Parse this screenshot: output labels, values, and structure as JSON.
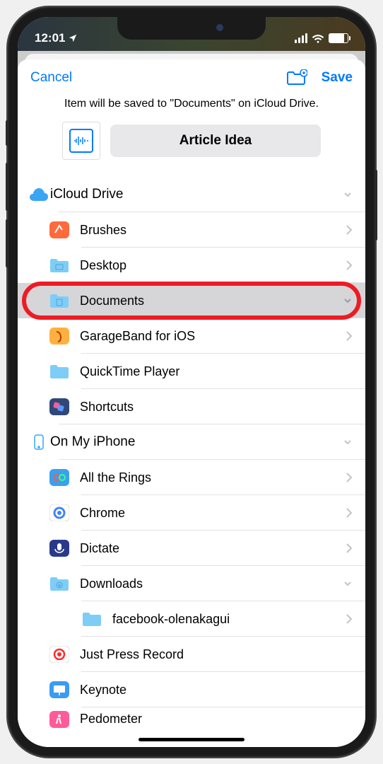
{
  "status": {
    "time": "12:01",
    "location_arrow": "➤"
  },
  "nav": {
    "cancel": "Cancel",
    "save": "Save"
  },
  "info_text": "Item will be saved to \"Documents\" on iCloud Drive.",
  "item_name": "Article Idea",
  "locations": [
    {
      "name": "iCloud Drive",
      "icon": "cloud",
      "expanded": true,
      "folders": [
        {
          "name": "Brushes",
          "icon_color": "#ff6a3c",
          "glyph": "brush",
          "chev": "right"
        },
        {
          "name": "Desktop",
          "icon_color": "#7ecdf7",
          "glyph": "desktop",
          "chev": "right"
        },
        {
          "name": "Documents",
          "icon_color": "#7ecdf7",
          "glyph": "doc",
          "chev": "down",
          "selected": true,
          "highlighted": true
        },
        {
          "name": "GarageBand for iOS",
          "icon_color": "#ff9a3c",
          "glyph": "guitar",
          "chev": "right"
        },
        {
          "name": "QuickTime Player",
          "icon_color": "#7ecdf7",
          "glyph": "folder",
          "chev": "none"
        },
        {
          "name": "Shortcuts",
          "icon_color": "#2a4a8a",
          "glyph": "shortcuts",
          "chev": "none"
        }
      ]
    },
    {
      "name": "On My iPhone",
      "icon": "iphone",
      "expanded": true,
      "folders": [
        {
          "name": "All the Rings",
          "icon_color": "#3aa0f0",
          "glyph": "rings",
          "chev": "right"
        },
        {
          "name": "Chrome",
          "icon_color": "#ffffff",
          "glyph": "chrome",
          "chev": "right"
        },
        {
          "name": "Dictate",
          "icon_color": "#2a3a8a",
          "glyph": "mic",
          "chev": "right"
        },
        {
          "name": "Downloads",
          "icon_color": "#7ecdf7",
          "glyph": "download",
          "chev": "down",
          "children": [
            {
              "name": "facebook-olenakagui",
              "icon_color": "#7ecdf7",
              "glyph": "folder",
              "chev": "right"
            }
          ]
        },
        {
          "name": "Just Press Record",
          "icon_color": "#ffffff",
          "glyph": "record",
          "chev": "none"
        },
        {
          "name": "Keynote",
          "icon_color": "#3a9bf5",
          "glyph": "keynote",
          "chev": "none"
        },
        {
          "name": "Pedometer",
          "icon_color": "#ff5a9a",
          "glyph": "walk",
          "chev": "none"
        }
      ]
    }
  ]
}
